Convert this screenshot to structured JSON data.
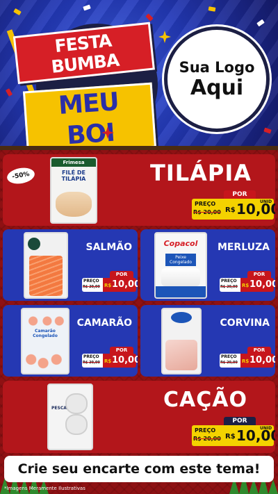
{
  "header": {
    "title_line1": "FESTA BUMBA",
    "title_line2": "MEU BOI",
    "logo_line1": "Sua Logo",
    "logo_line2": "Aqui"
  },
  "featured_top": {
    "name": "TILÁPIA",
    "discount": "-50%",
    "brand": "Frimesa",
    "package_text": "FILÉ DE TILÁPIA",
    "price": {
      "por": "POR",
      "preco": "PREÇO",
      "old": "R$ 20,00",
      "currency": "R$",
      "value": "10,00",
      "unit": "UNID"
    }
  },
  "grid": [
    {
      "name": "SALMÃO",
      "price": {
        "por": "POR",
        "preco": "PREÇO",
        "old": "R$ 20,00",
        "currency": "R$",
        "value": "10,00"
      }
    },
    {
      "name": "MERLUZA",
      "brand": "Copacol",
      "package_text": "Peixe Congelado",
      "price": {
        "por": "POR",
        "preco": "PREÇO",
        "old": "R$ 20,00",
        "currency": "R$",
        "value": "10,00"
      }
    },
    {
      "name": "CAMARÃO",
      "package_text": "Camarão Congelado",
      "price": {
        "por": "POR",
        "preco": "PREÇO",
        "old": "R$ 20,00",
        "currency": "R$",
        "value": "10,00"
      }
    },
    {
      "name": "CORVINA",
      "price": {
        "por": "POR",
        "preco": "PREÇO",
        "old": "R$ 20,00",
        "currency": "R$",
        "value": "10,00"
      }
    }
  ],
  "featured_bottom": {
    "name": "CAÇÃO",
    "package_text": "PESCADOS",
    "price": {
      "por": "POR",
      "preco": "PREÇO",
      "old": "R$ 20,00",
      "currency": "R$",
      "value": "10,00",
      "unit": "UNID"
    }
  },
  "cta": "Crie seu encarte com este tema!",
  "footnote": "*Imagens Meramente Ilustrativas",
  "colors": {
    "header_blue": "#2339b8",
    "board_red": "#8e1113",
    "card_red": "#b3161b",
    "card_blue": "#2538b3",
    "price_yellow": "#f4d200",
    "price_red": "#c7151c"
  }
}
